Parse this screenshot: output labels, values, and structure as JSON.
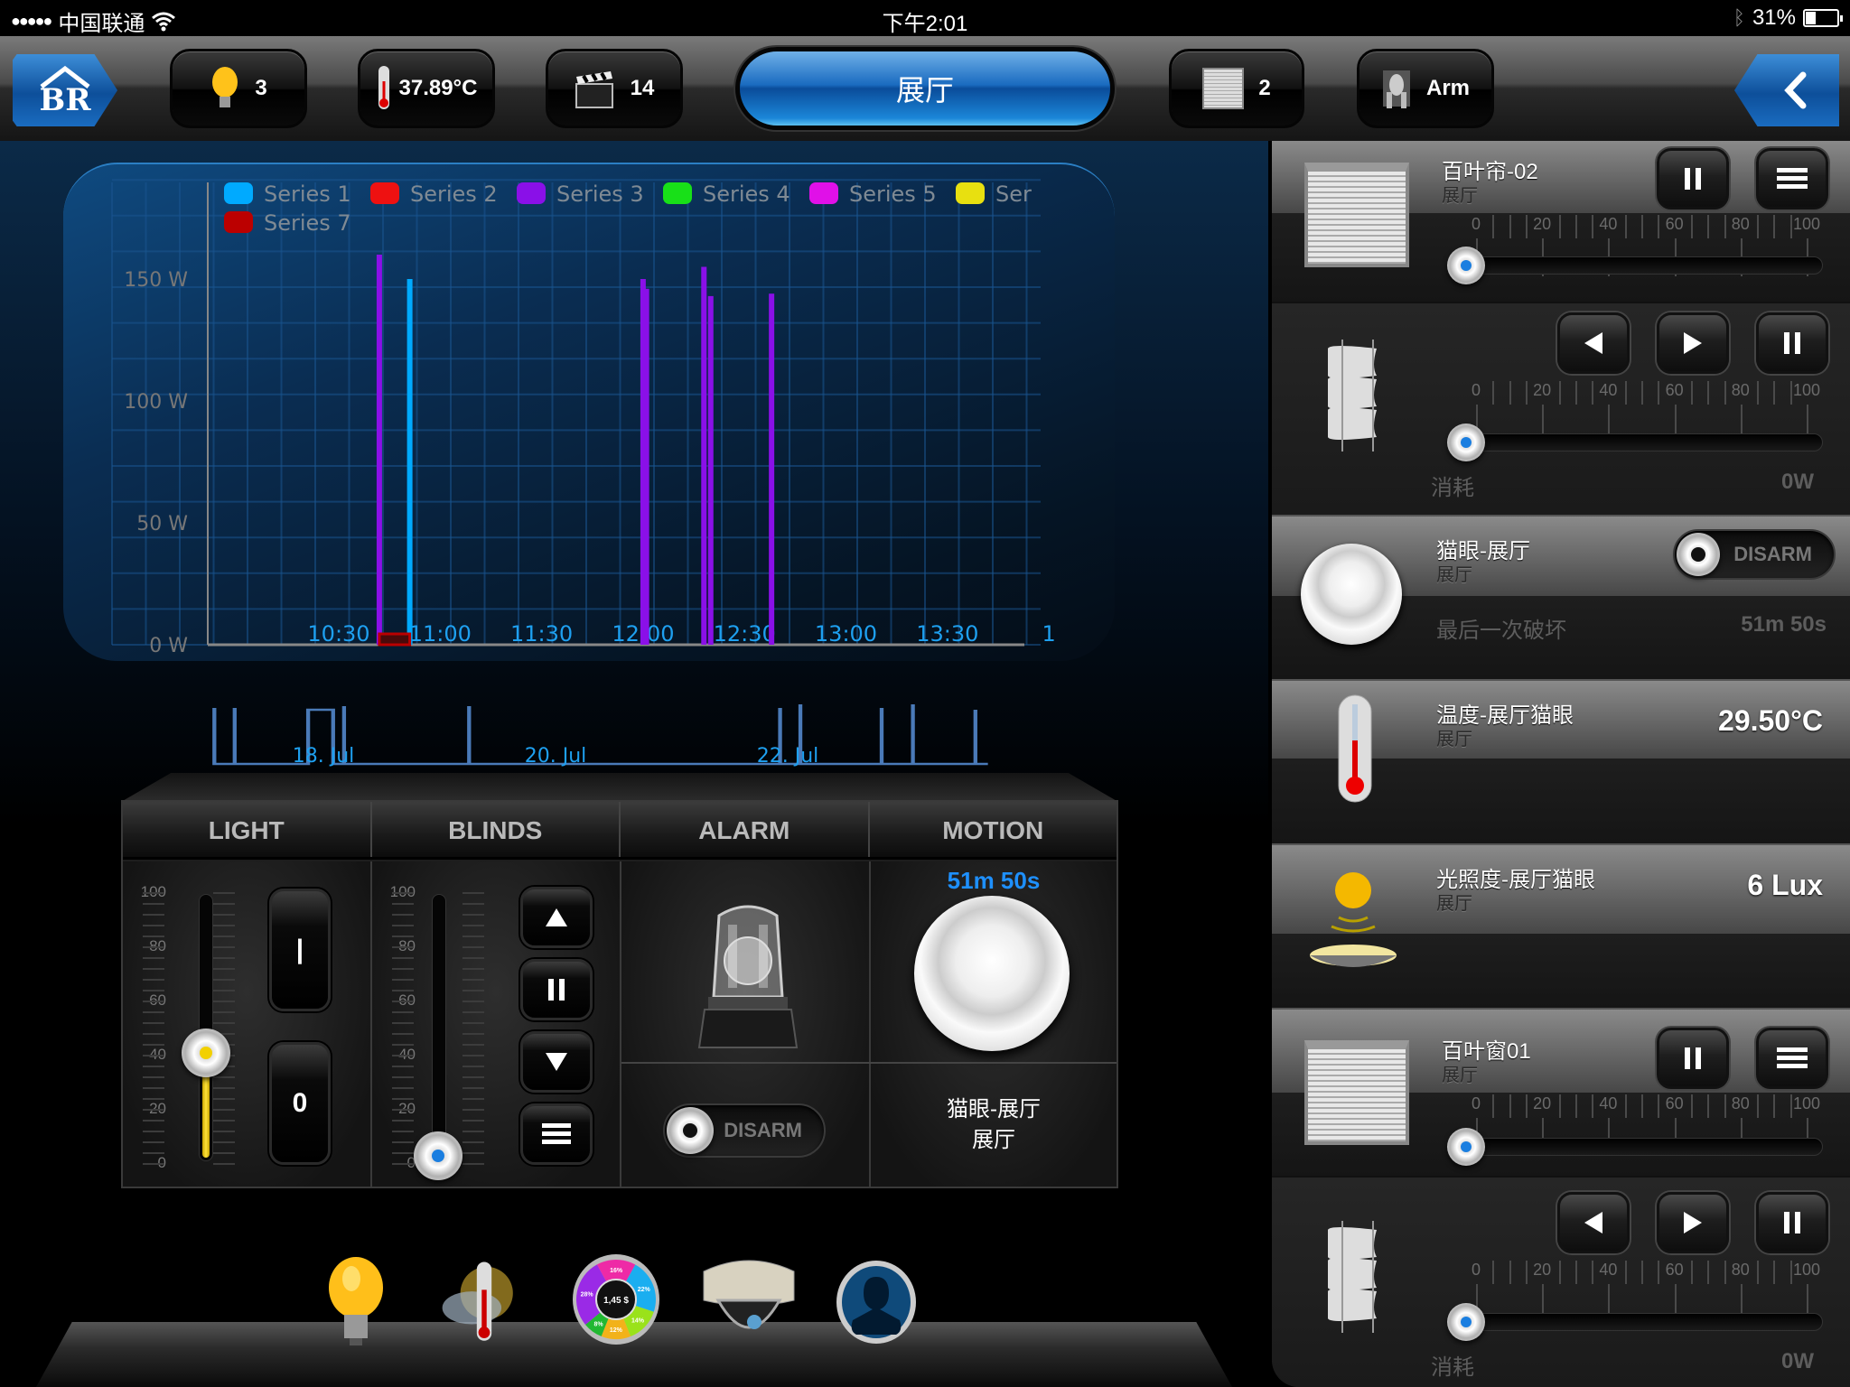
{
  "status_bar": {
    "signal": "●●●●●",
    "carrier": "中国联通",
    "time": "下午2:01",
    "battery_percent": "31%",
    "battery_level": 0.31
  },
  "toolbar": {
    "home_icon": "home-logo-icon",
    "lights_count": "3",
    "temperature": "37.89°C",
    "scenes_count": "14",
    "room_title": "展厅",
    "blinds_count": "2",
    "alarm_state": "Arm",
    "back_icon": "chevron-left-icon"
  },
  "chart_data": {
    "type": "bar",
    "title": "",
    "xlabel": "",
    "ylabel": "",
    "y_ticks": [
      "0 W",
      "50 W",
      "100 W",
      "150 W"
    ],
    "ylim": [
      0,
      170
    ],
    "x_ticks": [
      "10:30",
      "11:00",
      "11:30",
      "12:00",
      "12:30",
      "13:00",
      "13:30",
      "1"
    ],
    "xlim_minutes": [
      570,
      870
    ],
    "legend": [
      {
        "name": "Series 1",
        "color": "#00aaff"
      },
      {
        "name": "Series 2",
        "color": "#ee1111"
      },
      {
        "name": "Series 3",
        "color": "#8a10e8"
      },
      {
        "name": "Series 4",
        "color": "#18e018"
      },
      {
        "name": "Series 5",
        "color": "#e010e8"
      },
      {
        "name": "Ser",
        "color": "#e8e010"
      },
      {
        "name": "Series 7",
        "color": "#bb0000"
      }
    ],
    "legend_position": "top",
    "grid": true,
    "series": [
      {
        "name": "Series 3",
        "color": "#8a10e8",
        "points": [
          {
            "t": "10:42",
            "value": 160
          },
          {
            "t": "12:00",
            "value": 150
          },
          {
            "t": "12:01",
            "value": 146
          },
          {
            "t": "12:18",
            "value": 155
          },
          {
            "t": "12:20",
            "value": 143
          },
          {
            "t": "12:38",
            "value": 144
          }
        ]
      },
      {
        "name": "Series 1",
        "color": "#00aaff",
        "points": [
          {
            "t": "10:51",
            "value": 150
          }
        ]
      },
      {
        "name": "Series 7",
        "color": "#bb0000",
        "ranges": [
          {
            "from": "10:42",
            "to": "10:51",
            "value": 3
          }
        ]
      }
    ],
    "navigator": {
      "labels": [
        "18. Jul",
        "20. Jul",
        "22. Jul"
      ],
      "color": "#4a7ab8"
    }
  },
  "control_box": {
    "tabs": [
      "LIGHT",
      "BLINDS",
      "ALARM",
      "MOTION"
    ],
    "scale_labels": [
      "100",
      "80",
      "60",
      "40",
      "20",
      "0"
    ],
    "light": {
      "level_percent": 40,
      "on_label": "|",
      "off_label": "0"
    },
    "blinds": {
      "level_percent": 0,
      "up_icon": "triangle-up-icon",
      "pause_icon": "pause-icon",
      "down_icon": "triangle-down-icon",
      "menu_icon": "menu-icon"
    },
    "alarm": {
      "toggle_label": "DISARM"
    },
    "motion": {
      "elapsed": "51m 50s",
      "name_line1": "猫眼-展厅",
      "name_line2": "展厅"
    }
  },
  "dock": {
    "items": [
      {
        "name": "lighting",
        "icon": "lightbulb-icon"
      },
      {
        "name": "climate",
        "icon": "thermometer-weather-icon"
      },
      {
        "name": "energy",
        "icon": "energy-donut-icon",
        "center_label": "1,45 $",
        "slices": [
          "16%",
          "22%",
          "14%",
          "12%",
          "8%",
          "28%"
        ]
      },
      {
        "name": "camera",
        "icon": "security-camera-icon"
      },
      {
        "name": "security",
        "icon": "intruder-silhouette-icon"
      }
    ]
  },
  "right_panel": {
    "cards": [
      {
        "type": "blind",
        "title": "百叶帘-02",
        "room": "展厅",
        "position_scale": [
          "0",
          "20",
          "40",
          "60",
          "80",
          "100"
        ],
        "position_percent": 0,
        "tilt_scale": [
          "0",
          "20",
          "40",
          "60",
          "80",
          "100"
        ],
        "tilt_percent": 0,
        "consumption_label": "消耗",
        "consumption_value": "0W"
      },
      {
        "type": "motion",
        "title": "猫眼-展厅",
        "room": "展厅",
        "toggle_label": "DISARM",
        "last_breach_label": "最后一次破坏",
        "last_breach_value": "51m 50s"
      },
      {
        "type": "temperature",
        "title": "温度-展厅猫眼",
        "room": "展厅",
        "value": "29.50°C"
      },
      {
        "type": "lux",
        "title": "光照度-展厅猫眼",
        "room": "展厅",
        "value": "6 Lux"
      },
      {
        "type": "blind",
        "title": "百叶窗01",
        "room": "展厅",
        "position_scale": [
          "0",
          "20",
          "40",
          "60",
          "80",
          "100"
        ],
        "position_percent": 0,
        "tilt_scale": [
          "0",
          "20",
          "40",
          "60",
          "80",
          "100"
        ],
        "tilt_percent": 0,
        "consumption_label": "消耗",
        "consumption_value": "0W"
      }
    ]
  }
}
